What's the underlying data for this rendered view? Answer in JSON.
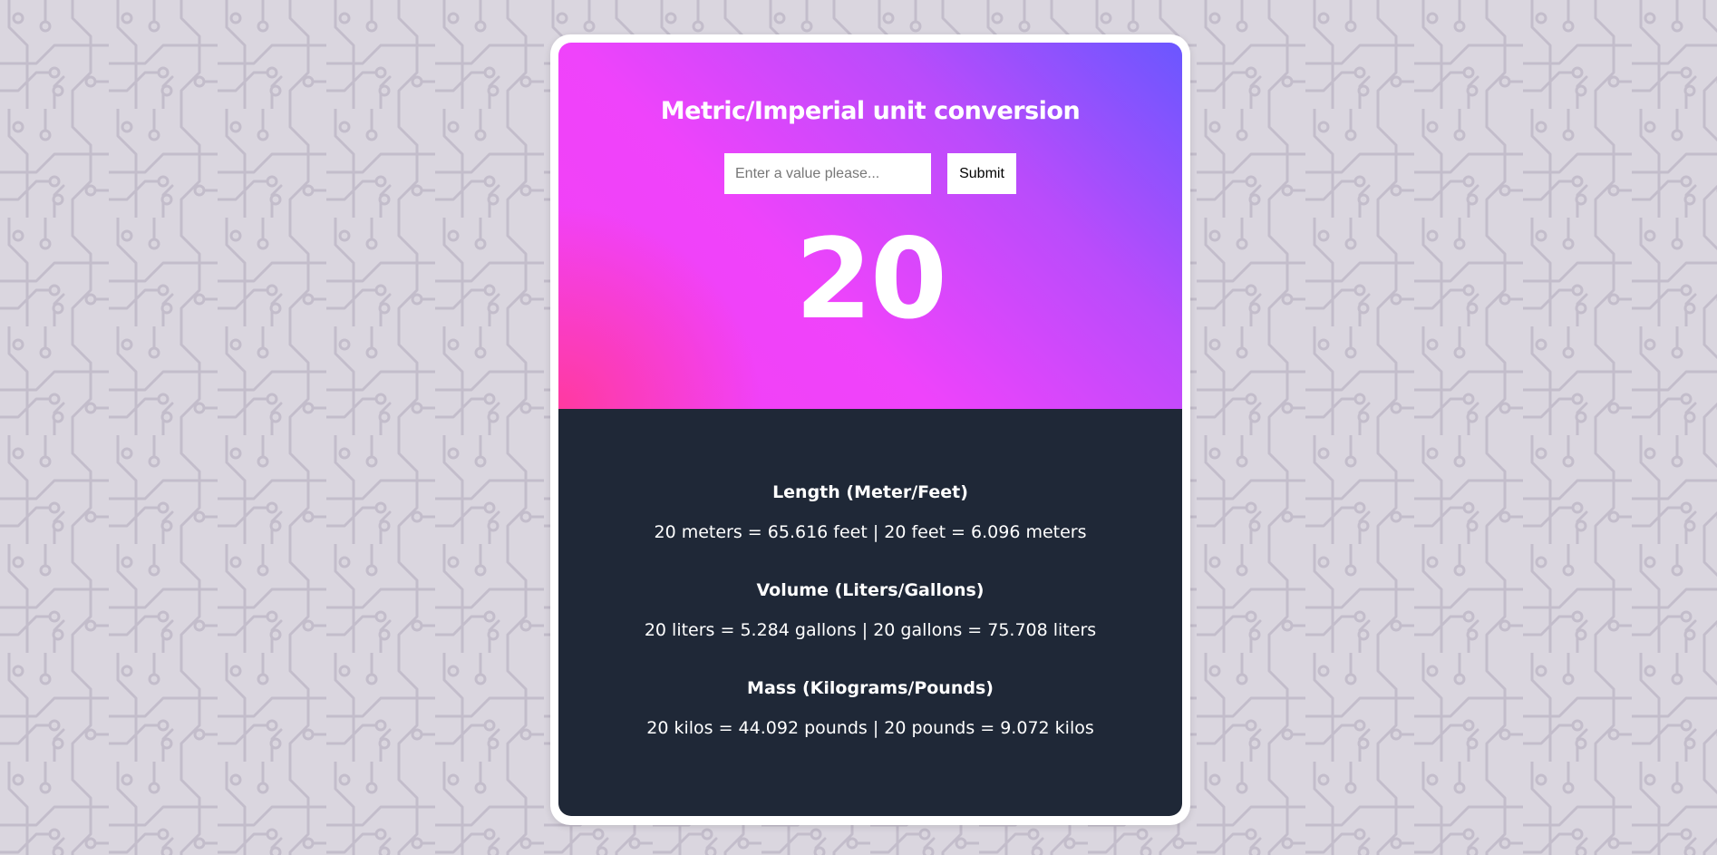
{
  "app": {
    "title": "Metric/Imperial unit conversion",
    "input_placeholder": "Enter a value please...",
    "submit_label": "Submit",
    "current_value": "20"
  },
  "conversions": [
    {
      "heading": "Length (Meter/Feet)",
      "result": "20 meters = 65.616 feet | 20 feet = 6.096 meters"
    },
    {
      "heading": "Volume (Liters/Gallons)",
      "result": "20 liters = 5.284 gallons | 20 gallons = 75.708 liters"
    },
    {
      "heading": "Mass (Kilograms/Pounds)",
      "result": "20 kilos = 44.092 pounds | 20 pounds = 9.072 kilos"
    }
  ],
  "colors": {
    "page_background": "#dad6df",
    "gradient_pink": "#f43ff3",
    "gradient_violet": "#6a57ff",
    "results_panel": "#1f2837",
    "text_light": "#ffffff"
  }
}
